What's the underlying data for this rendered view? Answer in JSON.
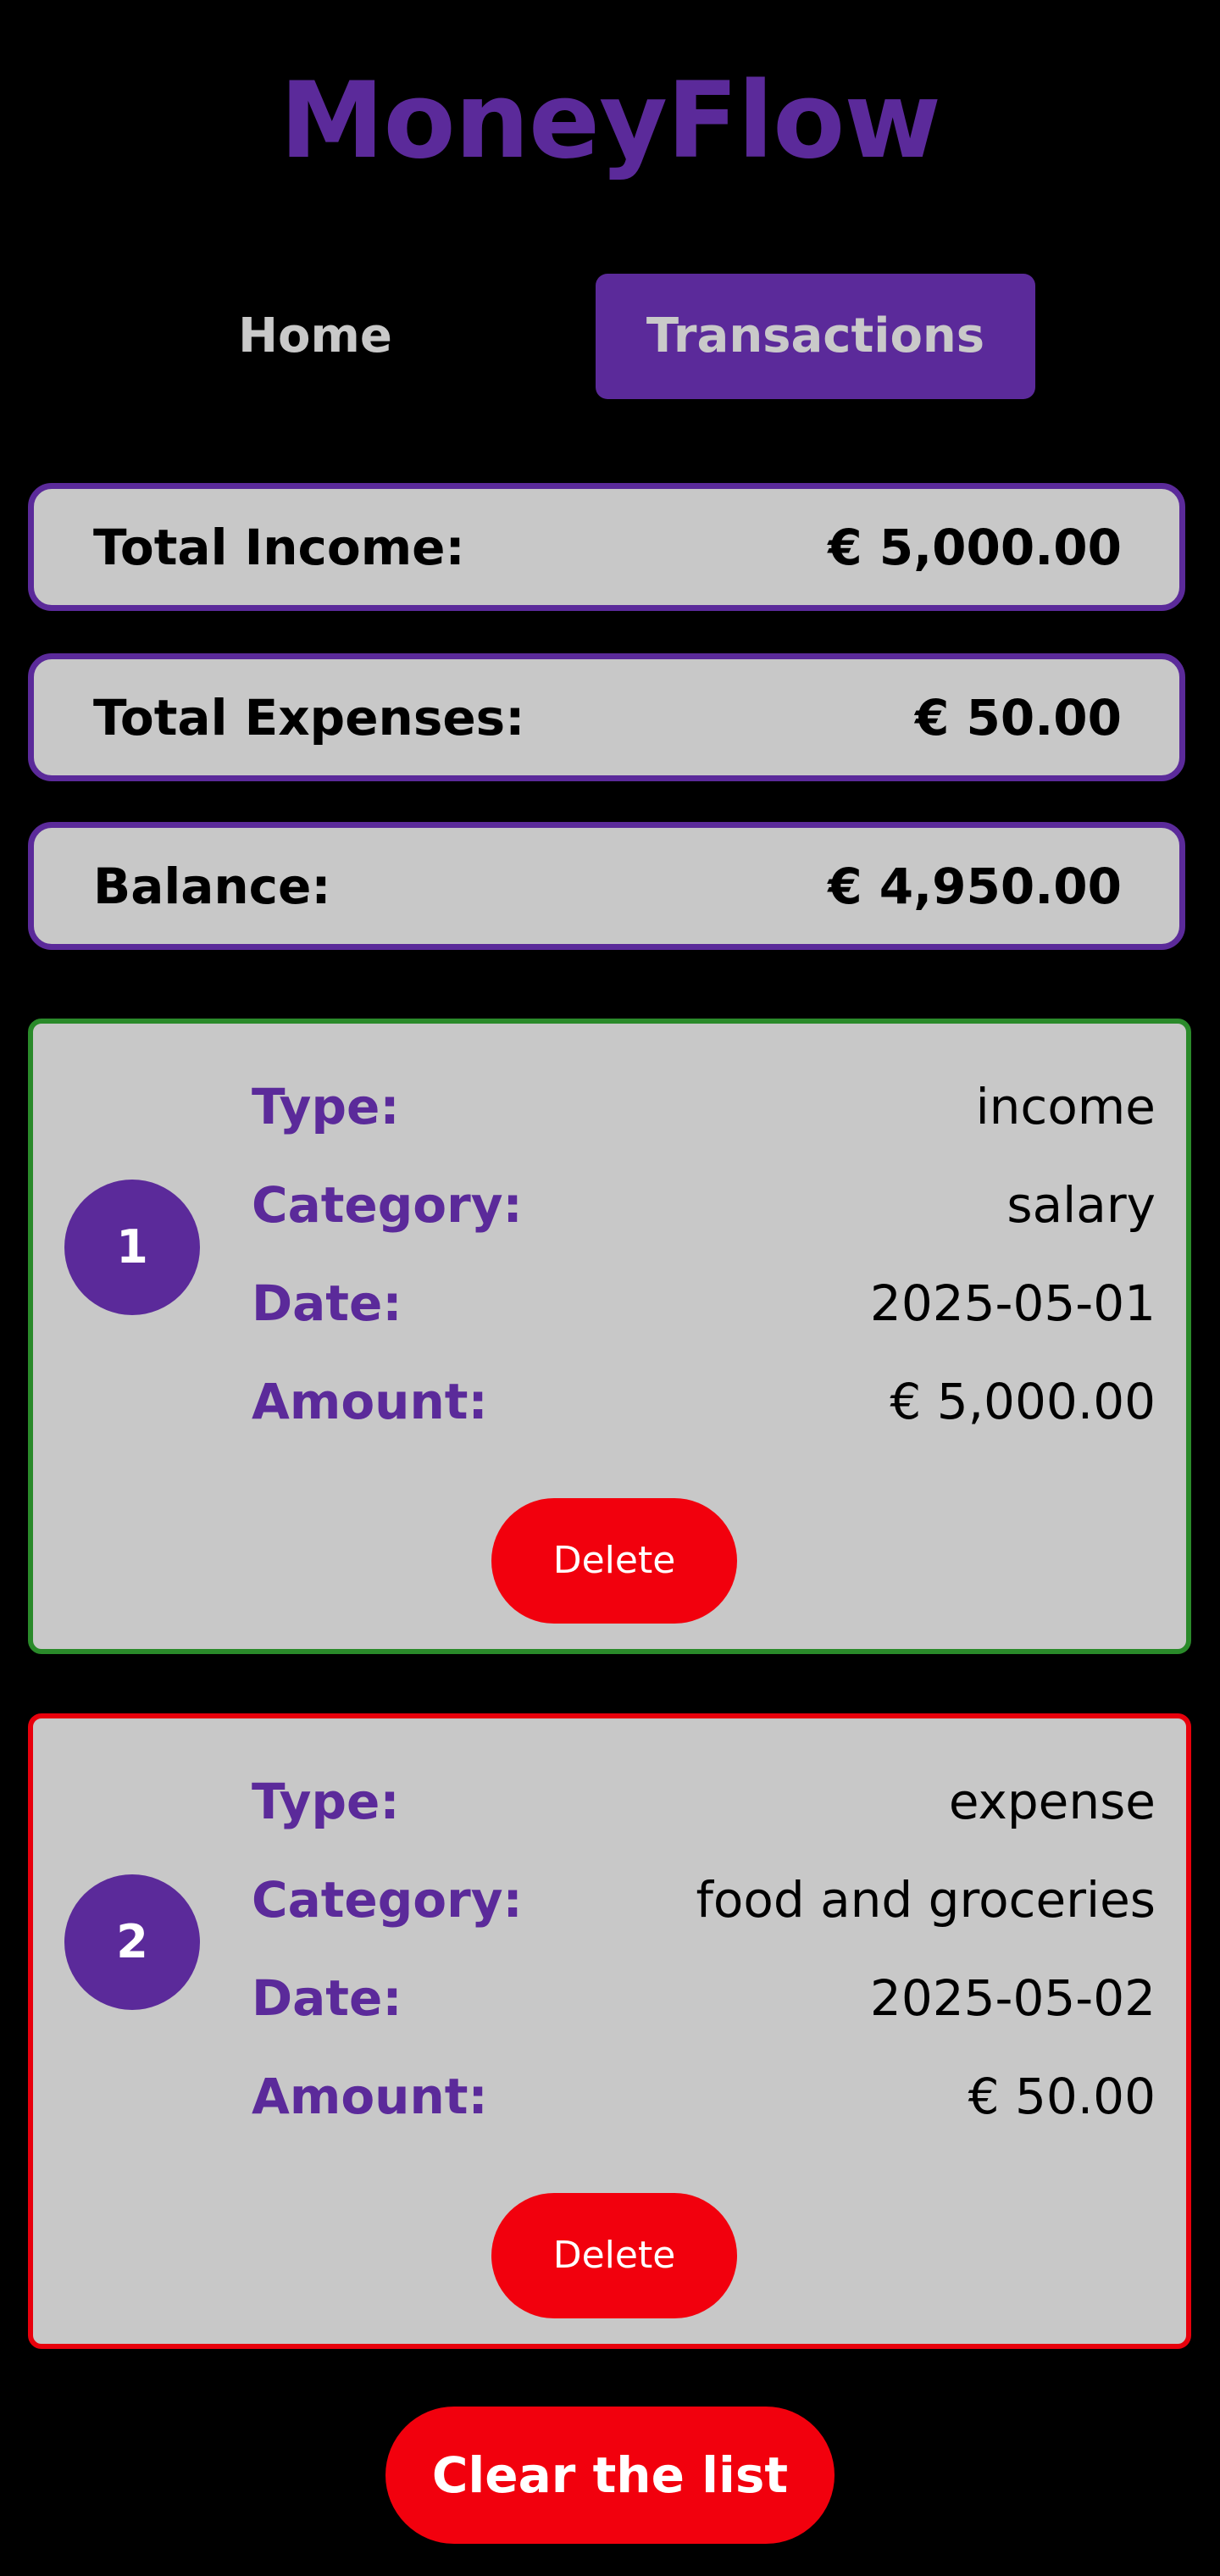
{
  "app": {
    "title": "MoneyFlow"
  },
  "nav": {
    "home_label": "Home",
    "transactions_label": "Transactions",
    "active": "Transactions"
  },
  "summary": {
    "income_label": "Total Income:",
    "income_value": "€ 5,000.00",
    "expenses_label": "Total Expenses:",
    "expenses_value": "€ 50.00",
    "balance_label": "Balance:",
    "balance_value": "€ 4,950.00"
  },
  "field_labels": {
    "type": "Type:",
    "category": "Category:",
    "date": "Date:",
    "amount": "Amount:"
  },
  "transactions": [
    {
      "index": "1",
      "type": "income",
      "category": "salary",
      "date": "2025-05-01",
      "amount": "€ 5,000.00",
      "delete_label": "Delete"
    },
    {
      "index": "2",
      "type": "expense",
      "category": "food and groceries",
      "date": "2025-05-02",
      "amount": "€ 50.00",
      "delete_label": "Delete"
    }
  ],
  "clear_label": "Clear the list",
  "colors": {
    "background": "#000000",
    "accent": "#5b2a9a",
    "card_bg": "#c8c8c8",
    "income_border": "#2a8a2a",
    "expense_border": "#e8000c",
    "danger": "#f2000d"
  }
}
